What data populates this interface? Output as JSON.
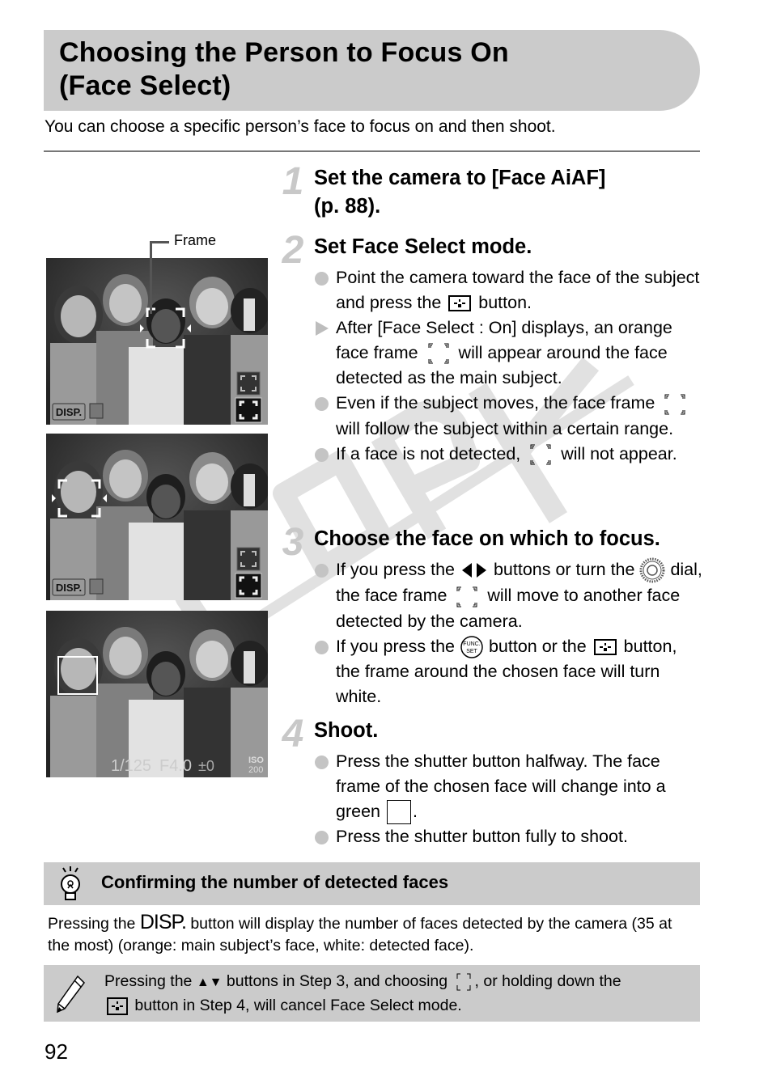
{
  "header": {
    "title_line1": "Choosing the Person to Focus On",
    "title_line2": "(Face Select)",
    "intro": "You can choose a specific person’s face to focus on and then shoot."
  },
  "watermark": {
    "text": "COPY"
  },
  "figure": {
    "frame_label": "Frame",
    "photo1": {
      "disp_label": "DISP.",
      "state": "orange face frame on center child"
    },
    "photo2": {
      "disp_label": "DISP.",
      "state": "face frame moved to left child"
    },
    "photo3": {
      "shutter": "1/125",
      "aperture": "F4.0",
      "exposure": "±0",
      "iso_label": "ISO",
      "iso_value": "200"
    }
  },
  "steps": [
    {
      "number": "1",
      "title": "Set the camera to [Face AiAF] (p. 88).",
      "title_line1": "Set the camera to [Face AiAF]",
      "title_line2": "(p. 88).",
      "bullets": []
    },
    {
      "number": "2",
      "title": "Set Face Select mode.",
      "bullets": [
        {
          "type": "circle",
          "parts": [
            "Point the camera toward the face of the subject and press the",
            "button."
          ]
        },
        {
          "type": "triangle",
          "parts": [
            "After [Face Select : On] displays, an orange face frame",
            "will appear around the face detected as the main subject."
          ]
        },
        {
          "type": "circle",
          "parts": [
            "Even if the subject moves, the face frame",
            "will follow the subject within a certain range."
          ]
        },
        {
          "type": "circle",
          "parts": [
            "If a face is not detected,",
            "will not appear."
          ]
        }
      ]
    },
    {
      "number": "3",
      "title": "Choose the face on which to focus.",
      "bullets": [
        {
          "type": "circle",
          "parts": [
            "If you press the",
            "buttons or turn the",
            "dial, the face frame",
            "will move to another face detected by the camera."
          ]
        },
        {
          "type": "circle",
          "parts": [
            "If you press the",
            "button or the",
            "button, the frame around the chosen face will turn white."
          ]
        }
      ]
    },
    {
      "number": "4",
      "title": "Shoot.",
      "bullets": [
        {
          "type": "circle",
          "parts": [
            "Press the shutter button halfway. The face frame of the chosen face will change into a green",
            "."
          ]
        },
        {
          "type": "circle",
          "parts": [
            "Press the shutter button fully to shoot."
          ]
        }
      ]
    }
  ],
  "icons": {
    "face_select_button": "face-select-button-icon",
    "face_frame": "face-frame-icon",
    "left_right": "left-right-arrows-icon",
    "control_dial": "control-dial-icon",
    "func_set": "func-set-button-icon",
    "func_set_text_top": "FUNC.",
    "func_set_text_bottom": "SET",
    "green_frame": "green-frame-icon"
  },
  "tip": {
    "title": "Confirming the number of detected faces",
    "body_before": "Pressing the",
    "disp_glyph": "DISP.",
    "body_after": "button will display the number of faces detected by the camera (35 at the most) (orange: main subject’s face, white: detected face)."
  },
  "note": {
    "part1": "Pressing the",
    "part2": "buttons in Step 3, and choosing",
    "part3": ", or holding down the",
    "part4": "button in Step 4, will cancel Face Select mode.",
    "up_down_glyph": "▲▼"
  },
  "page_number": "92"
}
